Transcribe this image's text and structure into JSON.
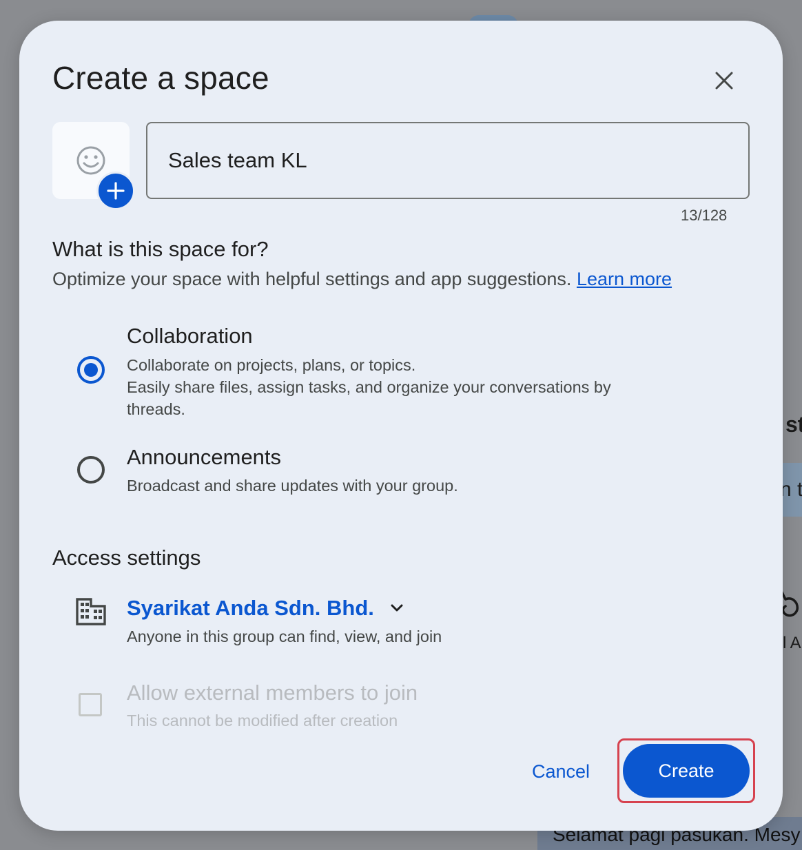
{
  "background": {
    "fragment_1": "st",
    "fragment_2": "n t",
    "fragment_3": "l A",
    "chat_snippet": "Selamat pagi pasukan. Mesy"
  },
  "dialog": {
    "title": "Create a space",
    "close_icon": "close-icon",
    "avatar": {
      "icon": "emoji-smile-icon",
      "add_icon": "plus-icon"
    },
    "name_field": {
      "value": "Sales team KL",
      "char_count": "13/128"
    },
    "purpose": {
      "heading": "What is this space for?",
      "subtitle": "Optimize your space with helpful settings and app suggestions.",
      "learn_more": "Learn more",
      "options": [
        {
          "title": "Collaboration",
          "line1": "Collaborate on projects, plans, or topics.",
          "line2": "Easily share files, assign tasks, and organize your conversations by threads.",
          "selected": true
        },
        {
          "title": "Announcements",
          "line1": "Broadcast and share updates with your group.",
          "selected": false
        }
      ]
    },
    "access": {
      "heading": "Access settings",
      "org_icon": "building-icon",
      "org_name": "Syarikat Anda Sdn. Bhd.",
      "org_desc": "Anyone in this group can find, view, and join",
      "external": {
        "title": "Allow external members to join",
        "desc": "This cannot be modified after creation",
        "checked": false,
        "disabled": true
      }
    },
    "actions": {
      "cancel": "Cancel",
      "create": "Create"
    }
  },
  "colors": {
    "accent": "#0b57d0",
    "dialog_bg": "#e9eef6",
    "highlight": "#d6424f",
    "disabled_text": "#b8bbbf"
  }
}
